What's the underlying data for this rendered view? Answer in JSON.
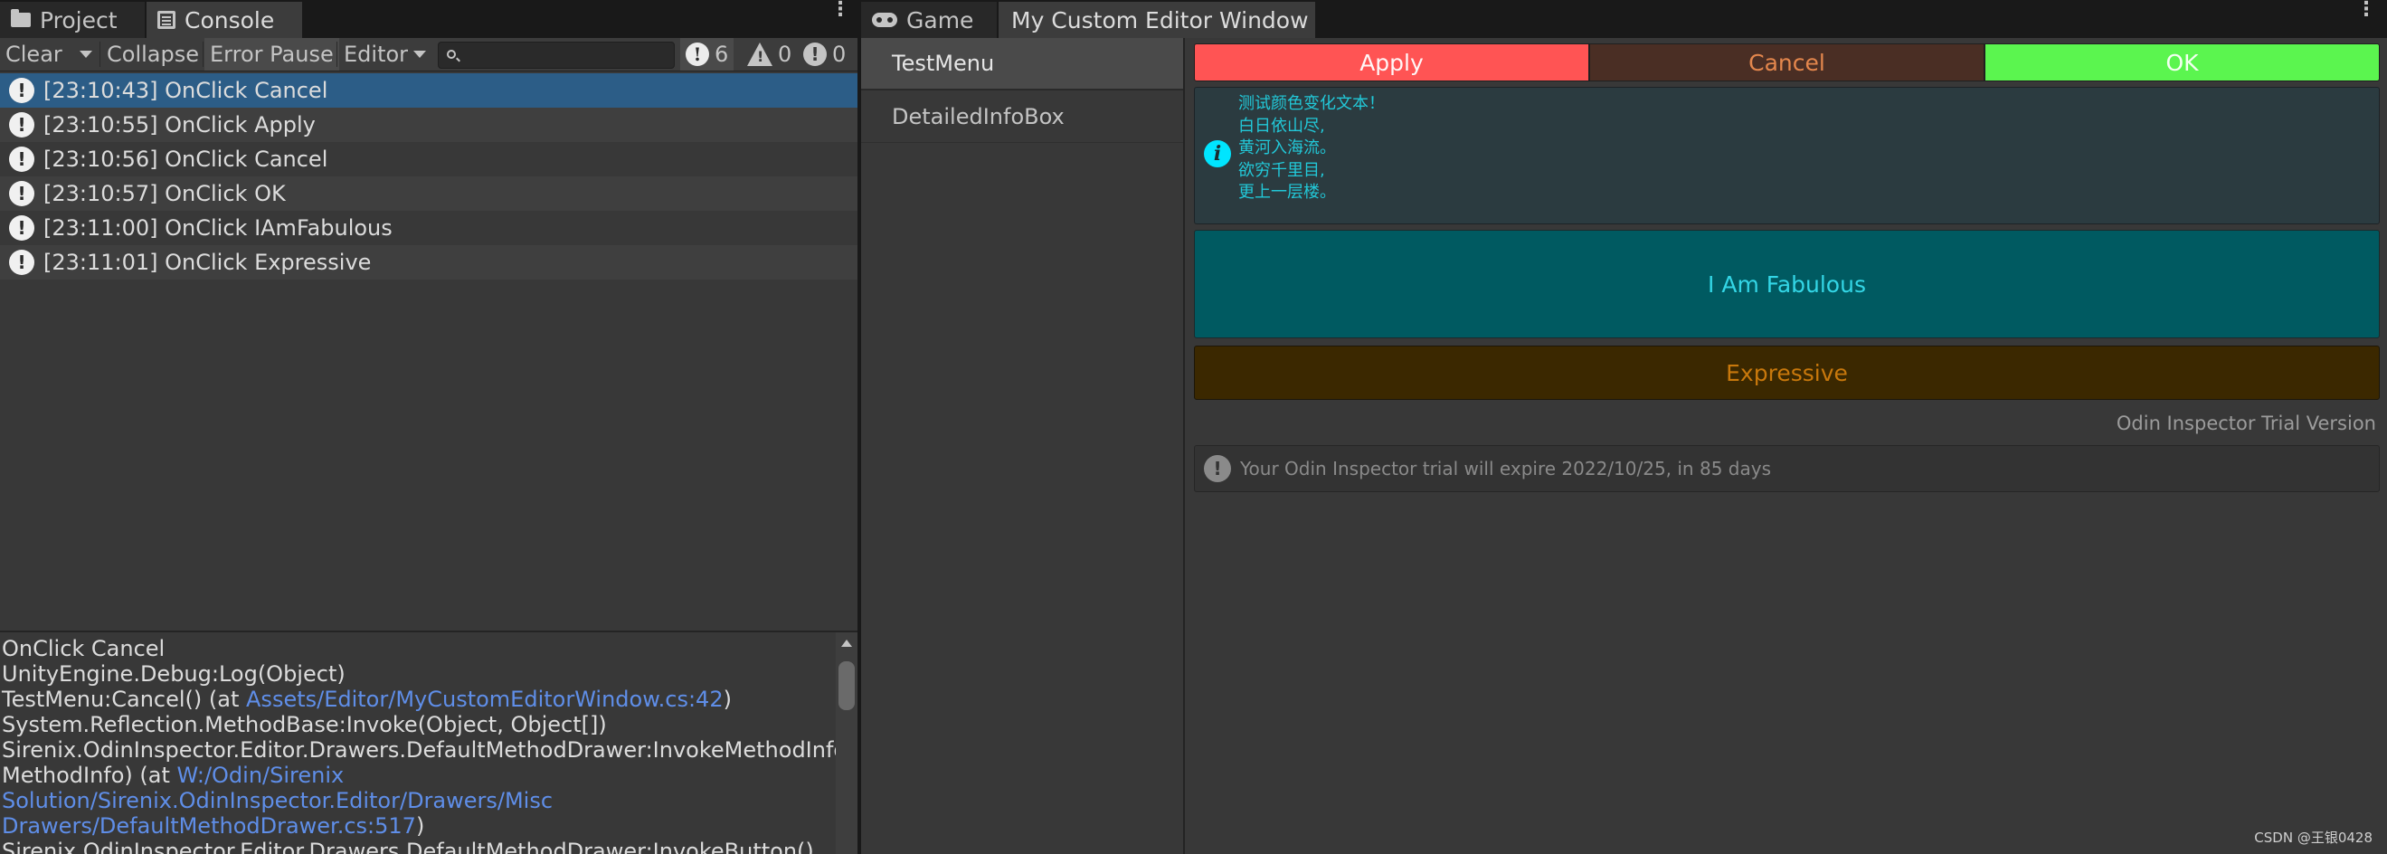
{
  "left_panel": {
    "tabs": [
      {
        "label": "Project",
        "icon": "folder-icon"
      },
      {
        "label": "Console",
        "icon": "console-icon"
      }
    ],
    "toolbar": {
      "clear_label": "Clear",
      "collapse_label": "Collapse",
      "error_pause_label": "Error Pause",
      "editor_label": "Editor",
      "search_placeholder": "",
      "info_count": "6",
      "warning_count": "0",
      "error_count": "0"
    },
    "log_entries": [
      {
        "text": "[23:10:43] OnClick Cancel",
        "selected": true
      },
      {
        "text": "[23:10:55] OnClick Apply",
        "selected": false
      },
      {
        "text": "[23:10:56] OnClick Cancel",
        "selected": false
      },
      {
        "text": "[23:10:57] OnClick OK",
        "selected": false
      },
      {
        "text": "[23:11:00] OnClick IAmFabulous",
        "selected": false
      },
      {
        "text": "[23:11:01] OnClick Expressive",
        "selected": false
      }
    ],
    "detail": {
      "line1": "OnClick Cancel",
      "line2": "UnityEngine.Debug:Log(Object)",
      "line3_prefix": "TestMenu:Cancel() (at ",
      "line3_link": "Assets/Editor/MyCustomEditorWindow.cs:42",
      "line3_suffix": ")",
      "line4": "System.Reflection.MethodBase:Invoke(Object, Object[])",
      "line5": "Sirenix.OdinInspector.Editor.Drawers.DefaultMethodDrawer:InvokeMethodInfo(",
      "line6_prefix": "MethodInfo) (at ",
      "line6_link": "W:/Odin/Sirenix",
      "line7_link": "Solution/Sirenix.OdinInspector.Editor/Drawers/Misc",
      "line8_link": "Drawers/DefaultMethodDrawer.cs:517",
      "line8_suffix": ")",
      "line9": "Sirenix.OdinInspector.Editor.Drawers.DefaultMethodDrawer:InvokeButton() (at"
    }
  },
  "right_panel": {
    "tabs": [
      {
        "label": "Game",
        "icon": "gamepad-icon"
      },
      {
        "label": "My Custom Editor Window"
      }
    ],
    "menu_items": [
      {
        "label": "TestMenu",
        "selected": true
      },
      {
        "label": "DetailedInfoBox",
        "selected": false
      }
    ],
    "buttons": {
      "apply": "Apply",
      "cancel": "Cancel",
      "ok": "OK",
      "fabulous": "I Am Fabulous",
      "expressive": "Expressive"
    },
    "info_box": {
      "lines": [
        "测试颜色变化文本！",
        "白日依山尽,",
        "黄河入海流。",
        "欲穷千里目,",
        "更上一层楼。"
      ]
    },
    "trial": {
      "label": "Odin Inspector Trial Version",
      "message": "Your Odin Inspector trial will expire 2022/10/25, in 85 days"
    }
  },
  "watermark": "CSDN @王银0428",
  "colors": {
    "apply": "#ff5454",
    "cancel": "#4a2e24",
    "ok": "#5bf54f",
    "fabulous": "#005a61",
    "expressive": "#3b2800",
    "selection": "#2c5d87"
  }
}
